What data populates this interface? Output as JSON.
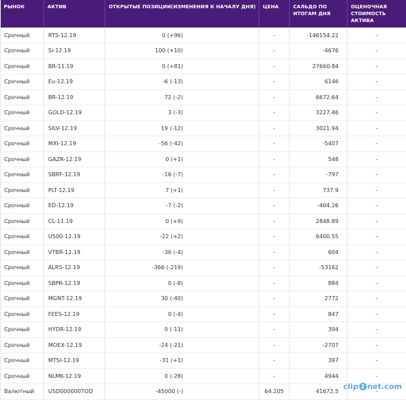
{
  "table": {
    "headers": {
      "market": "РЫНОК",
      "asset": "АКТИВ",
      "positions": "ОТКРЫТЫЕ ПОЗИЦИИ(ИЗМЕНЕНИЯ К НАЧАЛУ ДНЯ)",
      "price": "ЦЕНА",
      "balance": "САЛЬДО ПО ИТОГАМ ДНЯ",
      "valuation": "ОЦЕНОЧНАЯ СТОИМОСТЬ АКТИВА"
    },
    "rows": [
      {
        "market": "Срочный",
        "asset": "RTS-12.19",
        "positions": "0 (+96)",
        "price": "-",
        "balance": "-146154.22",
        "valuation": "-"
      },
      {
        "market": "Срочный",
        "asset": "Si-12.19",
        "positions": "100 (+10)",
        "price": "-",
        "balance": "-4676",
        "valuation": "-"
      },
      {
        "market": "Срочный",
        "asset": "BR-11.19",
        "positions": "0 (+81)",
        "price": "-",
        "balance": "27660.84",
        "valuation": "-"
      },
      {
        "market": "Срочный",
        "asset": "Eu-12.19",
        "positions": "-6 (-13)",
        "price": "-",
        "balance": "6146",
        "valuation": "-"
      },
      {
        "market": "Срочный",
        "asset": "BR-12.19",
        "positions": "72 (-2)",
        "price": "-",
        "balance": "6672.64",
        "valuation": "-"
      },
      {
        "market": "Срочный",
        "asset": "GOLD-12.19",
        "positions": "3 (-3)",
        "price": "-",
        "balance": "3227.46",
        "valuation": "-"
      },
      {
        "market": "Срочный",
        "asset": "SILV-12.19",
        "positions": "19 (-12)",
        "price": "-",
        "balance": "3021.94",
        "valuation": "-"
      },
      {
        "market": "Срочный",
        "asset": "MXI-12.19",
        "positions": "-56 (-42)",
        "price": "-",
        "balance": "-5407",
        "valuation": "-"
      },
      {
        "market": "Срочный",
        "asset": "GAZR-12.19",
        "positions": "0 (+1)",
        "price": "-",
        "balance": "548",
        "valuation": "-"
      },
      {
        "market": "Срочный",
        "asset": "SBRF-12.19",
        "positions": "-16 (-7)",
        "price": "-",
        "balance": "-797",
        "valuation": "-"
      },
      {
        "market": "Срочный",
        "asset": "PLT-12.19",
        "positions": "7 (+1)",
        "price": "-",
        "balance": "737.9",
        "valuation": "-"
      },
      {
        "market": "Срочный",
        "asset": "ED-12.19",
        "positions": "-7 (-2)",
        "price": "-",
        "balance": "-404.26",
        "valuation": "-"
      },
      {
        "market": "Срочный",
        "asset": "CL-11.19",
        "positions": "0 (+9)",
        "price": "-",
        "balance": "2848.89",
        "valuation": "-"
      },
      {
        "market": "Срочный",
        "asset": "U500-12.19",
        "positions": "-22 (+2)",
        "price": "-",
        "balance": "6400.55",
        "valuation": "-"
      },
      {
        "market": "Срочный",
        "asset": "VTBR-12.19",
        "positions": "-36 (-4)",
        "price": "-",
        "balance": "604",
        "valuation": "-"
      },
      {
        "market": "Срочный",
        "asset": "ALRS-12.19",
        "positions": "-366 (-219)",
        "price": "-",
        "balance": "-53162",
        "valuation": "-"
      },
      {
        "market": "Срочный",
        "asset": "SBPR-12.19",
        "positions": "0 (-8)",
        "price": "-",
        "balance": "884",
        "valuation": "-"
      },
      {
        "market": "Срочный",
        "asset": "MGNT-12.19",
        "positions": "30 (-40)",
        "price": "-",
        "balance": "2772",
        "valuation": "-"
      },
      {
        "market": "Срочный",
        "asset": "FEES-12.19",
        "positions": "0 (-4)",
        "price": "-",
        "balance": "847",
        "valuation": "-"
      },
      {
        "market": "Срочный",
        "asset": "HYDR-12.19",
        "positions": "0 (-11)",
        "price": "-",
        "balance": "394",
        "valuation": "-"
      },
      {
        "market": "Срочный",
        "asset": "MOEX-12.19",
        "positions": "-24 (-21)",
        "price": "-",
        "balance": "-2707",
        "valuation": "-"
      },
      {
        "market": "Срочный",
        "asset": "MTSI-12.19",
        "positions": "-31 (+1)",
        "price": "-",
        "balance": "397",
        "valuation": "-"
      },
      {
        "market": "Срочный",
        "asset": "NLMK-12.19",
        "positions": "0 (-28)",
        "price": "-",
        "balance": "4944",
        "valuation": "-"
      },
      {
        "market": "Валютный",
        "asset": "USD000000TOD",
        "positions": "-45000 (-)",
        "price": "64.205",
        "balance": "41672.5",
        "valuation": "-"
      }
    ]
  },
  "watermark": {
    "text_a": "clip",
    "mark": "2",
    "text_b": "net.com"
  },
  "colors": {
    "header_bg": "#4a1c79",
    "header_text": "#ffffff",
    "watermark": "#4aa3d8"
  }
}
